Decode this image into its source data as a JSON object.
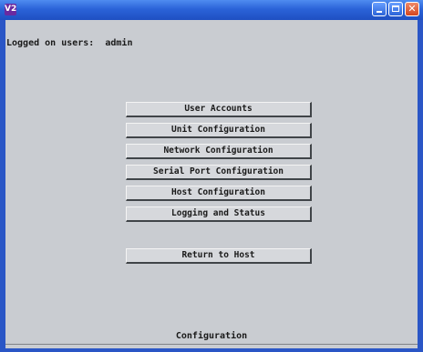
{
  "window": {
    "app_icon_text": "V2",
    "controls": [
      "minimize",
      "maximize",
      "close"
    ],
    "close_glyph": "✕"
  },
  "status": {
    "logged_on_text": "Logged on users:  admin"
  },
  "menu": {
    "items": [
      {
        "label": "User Accounts"
      },
      {
        "label": "Unit Configuration"
      },
      {
        "label": "Network Configuration"
      },
      {
        "label": "Serial Port Configuration"
      },
      {
        "label": "Host Configuration"
      },
      {
        "label": "Logging and Status"
      }
    ],
    "return_label": "Return to Host"
  },
  "footer": {
    "label": "Configuration"
  },
  "colors": {
    "titlebar": "#2b63d8",
    "background": "#c9ccd1",
    "button_face": "#d6d8dc",
    "close_button": "#d3461f"
  },
  "icons": [
    "app-icon",
    "minimize-icon",
    "maximize-icon",
    "close-icon"
  ]
}
